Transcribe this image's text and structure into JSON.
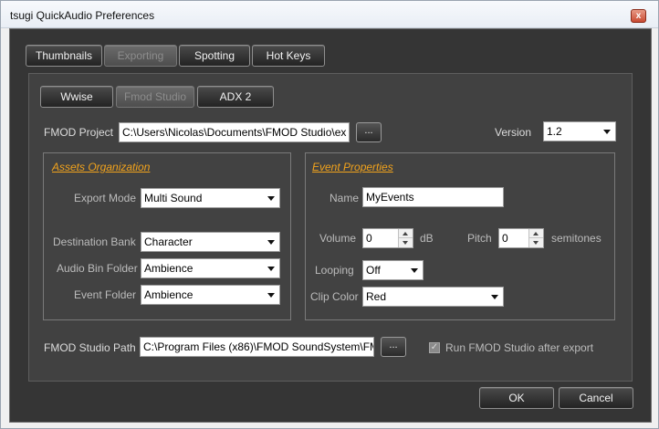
{
  "window": {
    "title": "tsugi QuickAudio Preferences",
    "close_glyph": "x"
  },
  "main_tabs": [
    {
      "label": "Thumbnails",
      "active": false
    },
    {
      "label": "Exporting",
      "active": true
    },
    {
      "label": "Spotting",
      "active": false
    },
    {
      "label": "Hot Keys",
      "active": false
    }
  ],
  "sub_tabs": [
    {
      "label": "Wwise",
      "active": false
    },
    {
      "label": "Fmod Studio",
      "active": true
    },
    {
      "label": "ADX 2",
      "active": false
    }
  ],
  "fmod_project": {
    "label": "FMOD Project",
    "value": "C:\\Users\\Nicolas\\Documents\\FMOD Studio\\ex",
    "browse_label": "..."
  },
  "version": {
    "label": "Version",
    "value": "1.2"
  },
  "assets_organization": {
    "title": "Assets Organization",
    "export_mode": {
      "label": "Export Mode",
      "value": "Multi Sound"
    },
    "destination_bank": {
      "label": "Destination Bank",
      "value": "Character"
    },
    "audio_bin_folder": {
      "label": "Audio Bin Folder",
      "value": "Ambience"
    },
    "event_folder": {
      "label": "Event Folder",
      "value": "Ambience"
    }
  },
  "event_properties": {
    "title": "Event Properties",
    "name": {
      "label": "Name",
      "value": "MyEvents"
    },
    "volume": {
      "label": "Volume",
      "value": "0",
      "unit": "dB"
    },
    "pitch": {
      "label": "Pitch",
      "value": "0",
      "unit": "semitones"
    },
    "looping": {
      "label": "Looping",
      "value": "Off"
    },
    "clip_color": {
      "label": "Clip Color",
      "value": "Red"
    }
  },
  "fmod_studio_path": {
    "label": "FMOD Studio Path",
    "value": "C:\\Program Files (x86)\\FMOD SoundSystem\\FM",
    "browse_label": "..."
  },
  "run_after_export": {
    "label": "Run FMOD Studio after export",
    "checked": true,
    "check_glyph": "✓"
  },
  "footer": {
    "ok_label": "OK",
    "cancel_label": "Cancel"
  },
  "colors": {
    "accent": "#f2a31c",
    "background": "#353535",
    "panel": "#414141"
  }
}
